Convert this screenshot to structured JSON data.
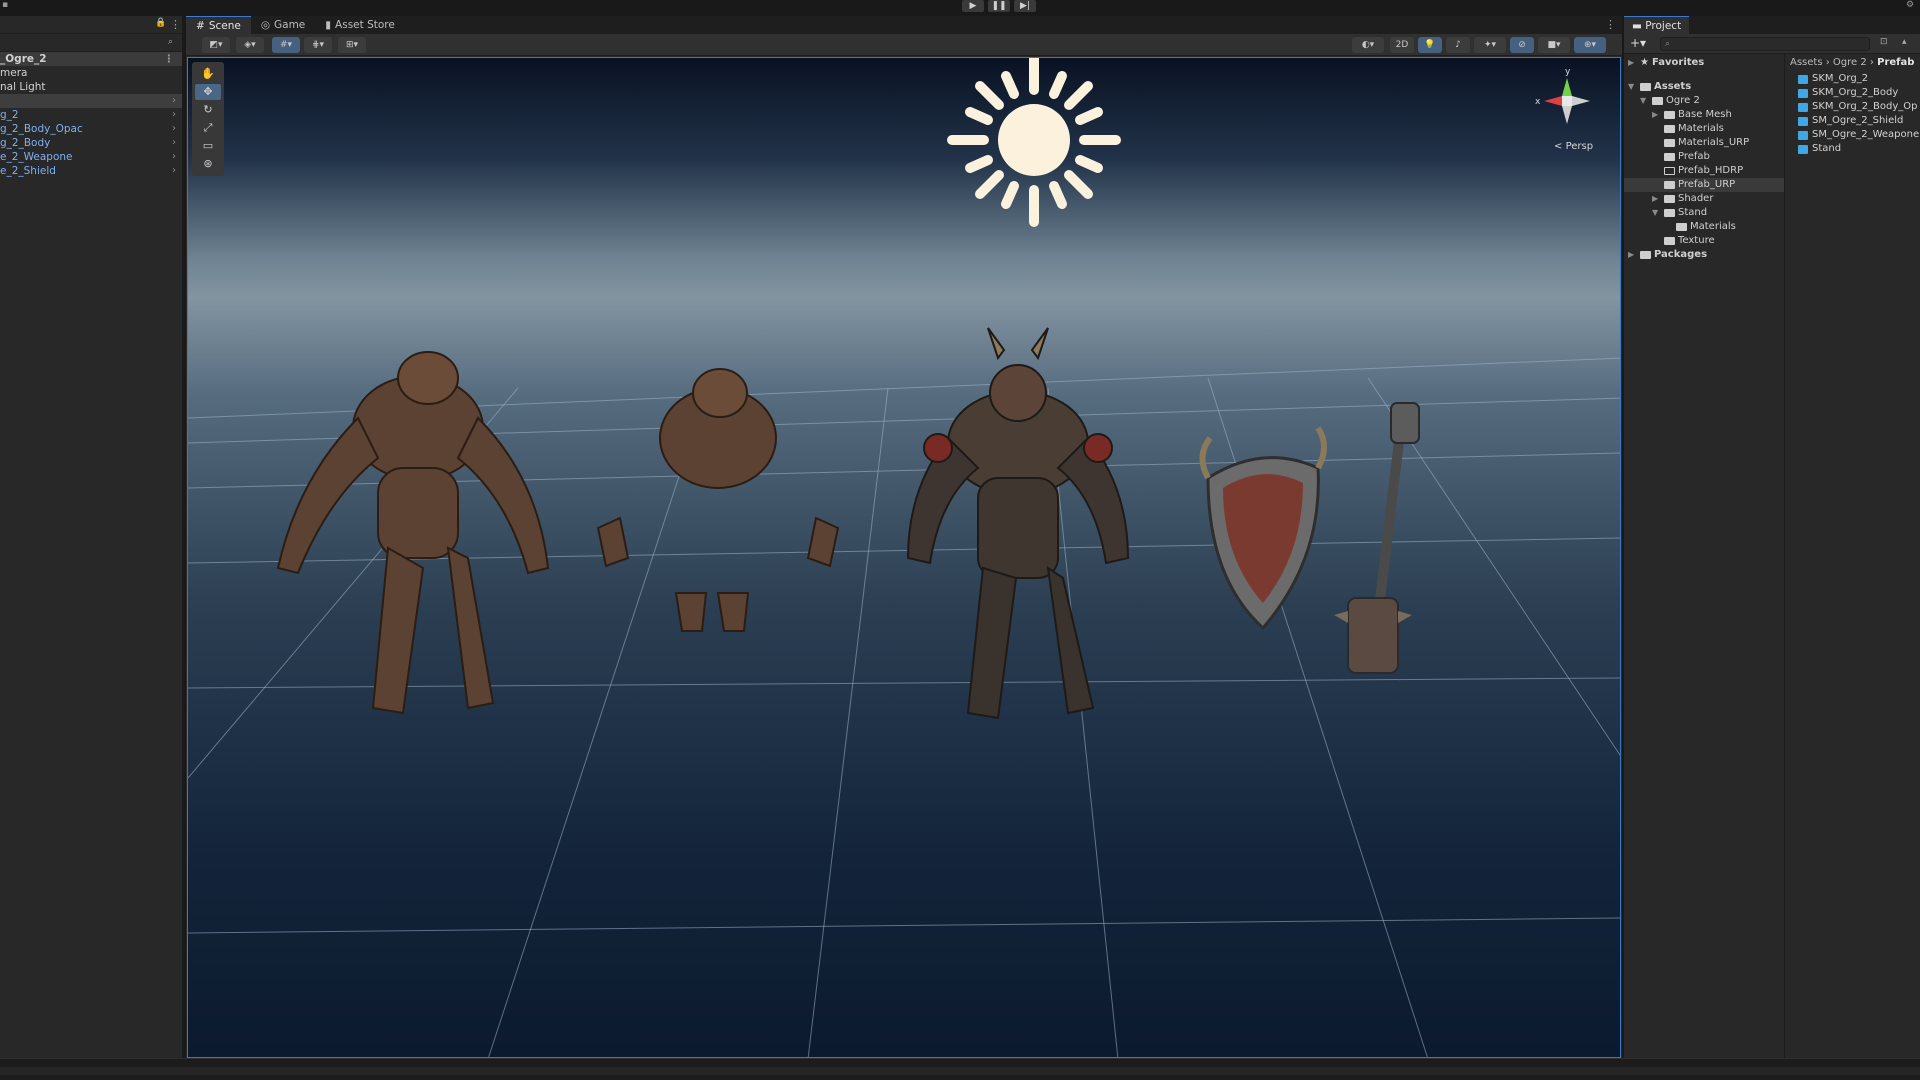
{
  "hierarchy": {
    "scene_name": "_Ogre_2",
    "items": [
      {
        "label": "mera",
        "kind": "plain"
      },
      {
        "label": "nal Light",
        "kind": "plain"
      },
      {
        "label": "",
        "kind": "selected"
      },
      {
        "label": "g_2",
        "kind": "prefab"
      },
      {
        "label": "g_2_Body_Opac",
        "kind": "prefab"
      },
      {
        "label": "g_2_Body",
        "kind": "prefab"
      },
      {
        "label": "e_2_Weapone",
        "kind": "prefab"
      },
      {
        "label": "e_2_Shield",
        "kind": "prefab"
      }
    ]
  },
  "scene_tabs": [
    {
      "label": "Scene",
      "icon": "grid-icon"
    },
    {
      "label": "Game",
      "icon": "gamepad-icon"
    },
    {
      "label": "Asset Store",
      "icon": "shopping-bag-icon"
    }
  ],
  "scene_toolbar": {
    "mode_2d_label": "2D"
  },
  "viewport": {
    "projection_label": "Persp",
    "gizmo_y_label": "y",
    "gizmo_x_label": "x"
  },
  "project": {
    "tab_label": "Project",
    "search_placeholder": "",
    "tree": [
      {
        "label": "Favorites",
        "level": 0,
        "bold": true,
        "icon": "star-icon"
      },
      {
        "label": "Assets",
        "level": 0,
        "bold": true,
        "icon": "folder-open-icon"
      },
      {
        "label": "Ogre 2",
        "level": 1,
        "bold": false,
        "icon": "folder-open-icon"
      },
      {
        "label": "Base Mesh",
        "level": 2,
        "bold": false,
        "icon": "folder-icon"
      },
      {
        "label": "Materials",
        "level": 2,
        "bold": false,
        "icon": "folder-icon"
      },
      {
        "label": "Materials_URP",
        "level": 2,
        "bold": false,
        "icon": "folder-icon"
      },
      {
        "label": "Prefab",
        "level": 2,
        "bold": false,
        "icon": "folder-icon"
      },
      {
        "label": "Prefab_HDRP",
        "level": 2,
        "bold": false,
        "icon": "folder-empty-icon"
      },
      {
        "label": "Prefab_URP",
        "level": 2,
        "bold": false,
        "icon": "folder-icon",
        "selected": true
      },
      {
        "label": "Shader",
        "level": 2,
        "bold": false,
        "icon": "folder-icon"
      },
      {
        "label": "Stand",
        "level": 2,
        "bold": false,
        "icon": "folder-open-icon"
      },
      {
        "label": "Materials",
        "level": 3,
        "bold": false,
        "icon": "folder-icon"
      },
      {
        "label": "Texture",
        "level": 2,
        "bold": false,
        "icon": "folder-icon"
      },
      {
        "label": "Packages",
        "level": 0,
        "bold": true,
        "icon": "folder-icon"
      }
    ],
    "breadcrumb": [
      "Assets",
      "Ogre 2",
      "Prefab"
    ],
    "files": [
      "SKM_Org_2",
      "SKM_Org_2_Body",
      "SKM_Org_2_Body_Op",
      "SM_Ogre_2_Shield",
      "SM_Ogre_2_Weapone",
      "Stand"
    ]
  },
  "colors": {
    "accent": "#3b7bd1",
    "prefab_text": "#7fb0f0",
    "prefab_icon": "#3fa7e6",
    "sun": "#fbf1dc"
  }
}
